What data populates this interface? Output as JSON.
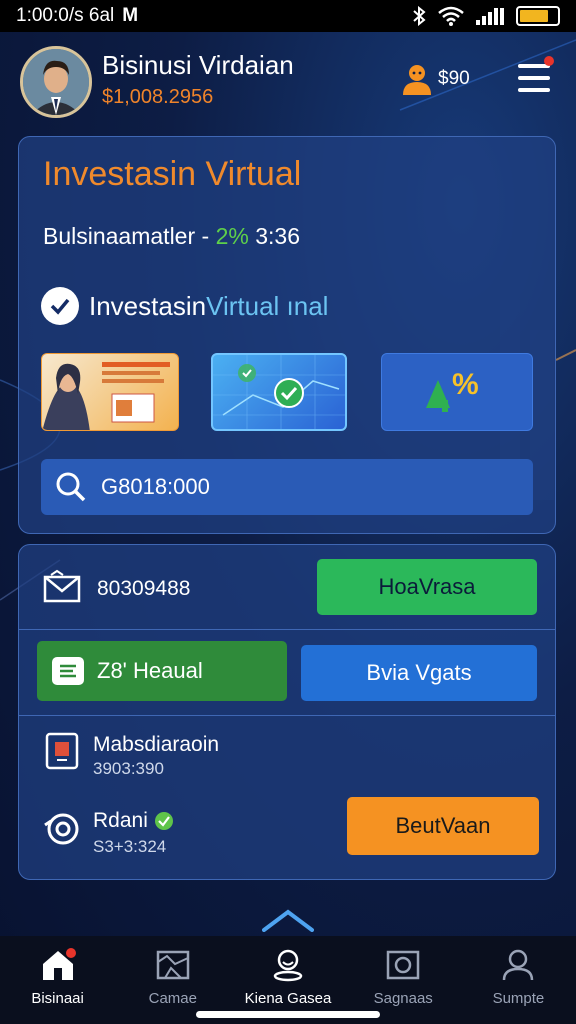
{
  "status_bar": {
    "time": "1:00:0/s 6al",
    "carrier_mark": "M"
  },
  "header": {
    "user_name": "Bisinusi Virdaian",
    "balance": "$1,008.2956",
    "coins": "$90"
  },
  "invest_card": {
    "title": "Investasin Virtual",
    "subtitle_text": "Bulsinaamatler - ",
    "subtitle_pct": "2%",
    "subtitle_time": " 3:36",
    "check_label_prefix": "Investasin ",
    "check_label_highlight": "Virtual ınal",
    "thumb3_text": "%",
    "search_value": "G8018:000"
  },
  "actions_card": {
    "row1_value": "80309488",
    "row1_button": "HoaVrasa",
    "row2_left_button": "Z8' Heaual",
    "row2_right_button": "Bvia Vgats",
    "row3_title": "Mabsdiaraoin",
    "row3_value": "3903:390",
    "row4_title": "Rdani",
    "row4_value": "S3+3:324",
    "row4_button": "BeutVaan"
  },
  "bottom_nav": {
    "items": [
      {
        "label": "Bisinaai",
        "icon": "home-icon"
      },
      {
        "label": "Camae",
        "icon": "map-icon"
      },
      {
        "label": "Kiena Gasea",
        "icon": "person-location-icon"
      },
      {
        "label": "Sagnaas",
        "icon": "camera-icon"
      },
      {
        "label": "Sumpte",
        "icon": "profile-icon"
      }
    ]
  },
  "colors": {
    "accent_orange": "#f08a2c",
    "accent_green": "#2bb85a",
    "accent_blue": "#2370d6",
    "background": "#0d1d45"
  }
}
